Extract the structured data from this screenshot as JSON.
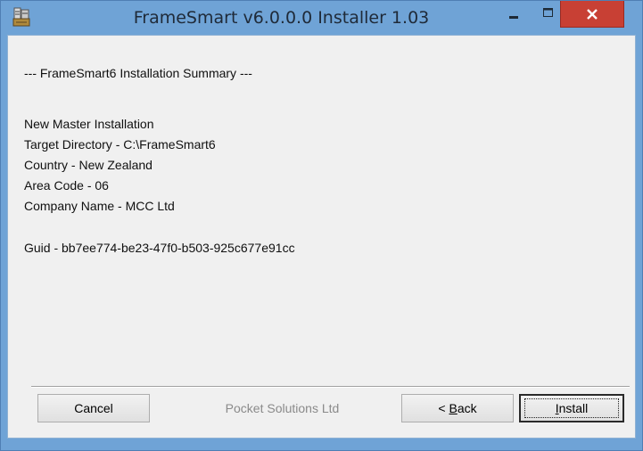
{
  "window": {
    "title": "FrameSmart v6.0.0.0 Installer 1.03",
    "icon": "installer-app-icon",
    "controls": {
      "minimize_icon": "minimize-icon",
      "maximize_icon": "maximize-icon",
      "close_icon": "close-icon"
    },
    "colors": {
      "frame": "#6fa3d6",
      "close_button": "#c84034",
      "client": "#f0f0f0"
    }
  },
  "summary": {
    "heading": "--- FrameSmart6 Installation Summary ---",
    "install_type": "New Master Installation",
    "target_directory": "Target Directory - C:\\FrameSmart6",
    "country": "Country - New Zealand",
    "area_code": "Area Code - 06",
    "company_name": "Company Name - MCC Ltd",
    "guid": "Guid - bb7ee774-be23-47f0-b503-925c677e91cc"
  },
  "footer": {
    "cancel_label": "Cancel",
    "brand": "Pocket Solutions Ltd",
    "back_label_prefix": "< ",
    "back_label_access": "B",
    "back_label_rest": "ack",
    "install_label_access": "I",
    "install_label_rest": "nstall"
  }
}
